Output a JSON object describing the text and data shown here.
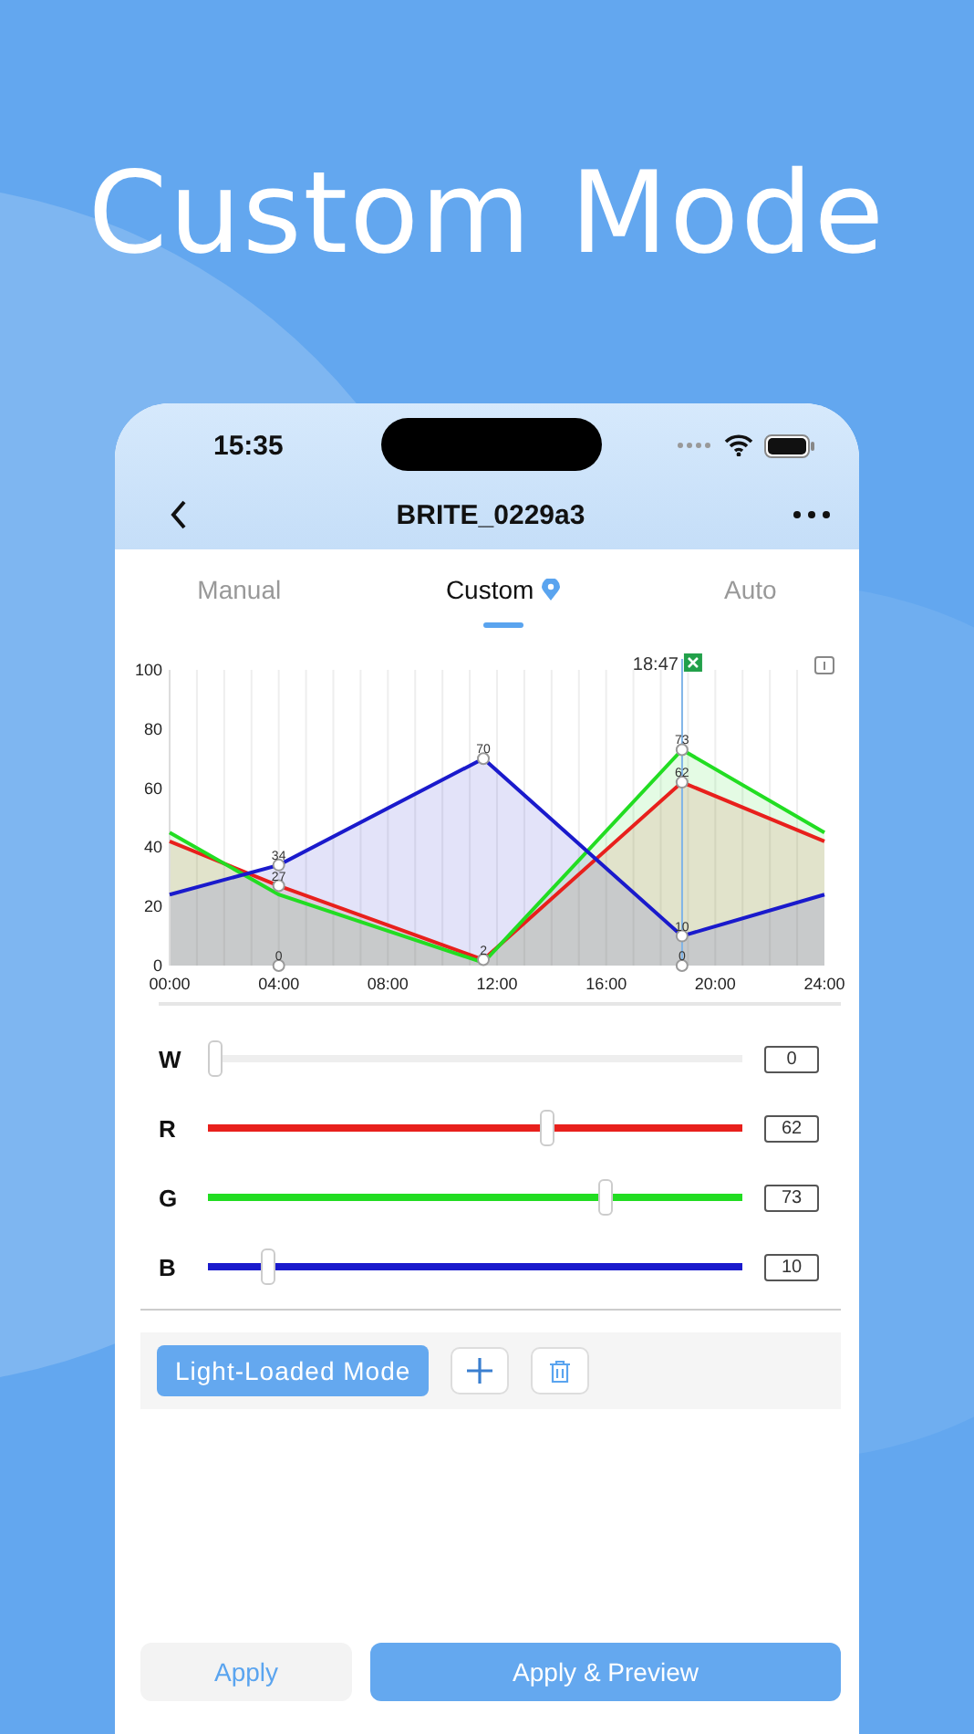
{
  "headline": "Custom Mode",
  "status_bar": {
    "time": "15:35"
  },
  "nav": {
    "title": "BRITE_0229a3"
  },
  "tabs": [
    {
      "label": "Manual",
      "selected": false,
      "pinned": false
    },
    {
      "label": "Custom",
      "selected": true,
      "pinned": true
    },
    {
      "label": "Auto",
      "selected": false,
      "pinned": false
    }
  ],
  "chart": {
    "cursor_label": "18:47",
    "chart_data": {
      "type": "area",
      "grid": true,
      "x": [
        0,
        4,
        11.5,
        18.78,
        24
      ],
      "xlim": [
        0,
        24
      ],
      "ylim": [
        0,
        100
      ],
      "ref_lines": [
        {
          "axis": "x",
          "value": 18.7833
        }
      ],
      "xticks": [
        {
          "value": 0,
          "label": "00:00"
        },
        {
          "value": 4,
          "label": "04:00"
        },
        {
          "value": 8,
          "label": "08:00"
        },
        {
          "value": 12,
          "label": "12:00"
        },
        {
          "value": 16,
          "label": "16:00"
        },
        {
          "value": 20,
          "label": "20:00"
        },
        {
          "value": 24,
          "label": "24:00"
        }
      ],
      "yticks": [
        0,
        20,
        40,
        60,
        80,
        100
      ],
      "series": [
        {
          "color": "#e8201c",
          "values": [
            42,
            27,
            2,
            62,
            42
          ]
        },
        {
          "color": "#22dd22",
          "values": [
            45,
            24,
            1,
            73,
            45
          ]
        },
        {
          "color": "#1a1acc",
          "values": [
            24,
            34,
            70,
            10,
            24
          ]
        }
      ],
      "annotations": [
        {
          "x": 4,
          "y": 34,
          "text": "34"
        },
        {
          "x": 4,
          "y": 27,
          "text": "27"
        },
        {
          "x": 4,
          "y": 0,
          "text": "0"
        },
        {
          "x": 11.5,
          "y": 70,
          "text": "70"
        },
        {
          "x": 11.5,
          "y": 2,
          "text": "2"
        },
        {
          "x": 18.78,
          "y": 73,
          "text": "73"
        },
        {
          "x": 18.78,
          "y": 62,
          "text": "62"
        },
        {
          "x": 18.78,
          "y": 10,
          "text": "10"
        },
        {
          "x": 18.78,
          "y": 0,
          "text": "0"
        }
      ]
    }
  },
  "channels": [
    {
      "name": "W",
      "color": "#eeeeee",
      "level": 0,
      "reading": "0"
    },
    {
      "name": "R",
      "color": "#e8201c",
      "level": 0.62,
      "reading": "62"
    },
    {
      "name": "G",
      "color": "#22dd22",
      "level": 0.73,
      "reading": "73"
    },
    {
      "name": "B",
      "color": "#1a1acc",
      "level": 0.1,
      "reading": "10"
    }
  ],
  "mode_chip": "Light-Loaded Mode",
  "buttons": [
    {
      "label": "Apply",
      "kind": "secondary"
    },
    {
      "label": "Apply & Preview",
      "kind": "primary"
    }
  ]
}
